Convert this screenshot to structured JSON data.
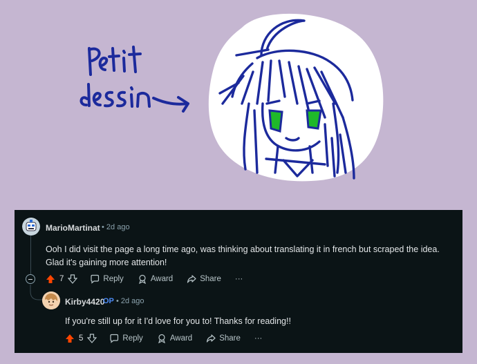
{
  "drawing": {
    "caption_line1": "Petit",
    "caption_line2": "dessin"
  },
  "comments": [
    {
      "username": "MarioMartinat",
      "op_badge": "",
      "separator": "•",
      "time": "2d ago",
      "text": "Ooh I did visit the page a long time ago, was thinking about translating it in french but scraped the idea. Glad it's gaining more attention!",
      "votes": "7",
      "reply_label": "Reply",
      "award_label": "Award",
      "share_label": "Share",
      "more_label": "···"
    },
    {
      "username": "Kirby4420",
      "op_badge": "OP",
      "separator": "•",
      "time": "2d ago",
      "text": "If you're still up for it I'd love for you to! Thanks for reading!!",
      "votes": "5",
      "reply_label": "Reply",
      "award_label": "Award",
      "share_label": "Share",
      "more_label": "···"
    }
  ],
  "colors": {
    "ink": "#1c2a9c",
    "eyes": "#1fb82a",
    "upvote": "#ff4500",
    "panel_bg": "#0b1416",
    "page_bg": "#c5b6d1"
  }
}
